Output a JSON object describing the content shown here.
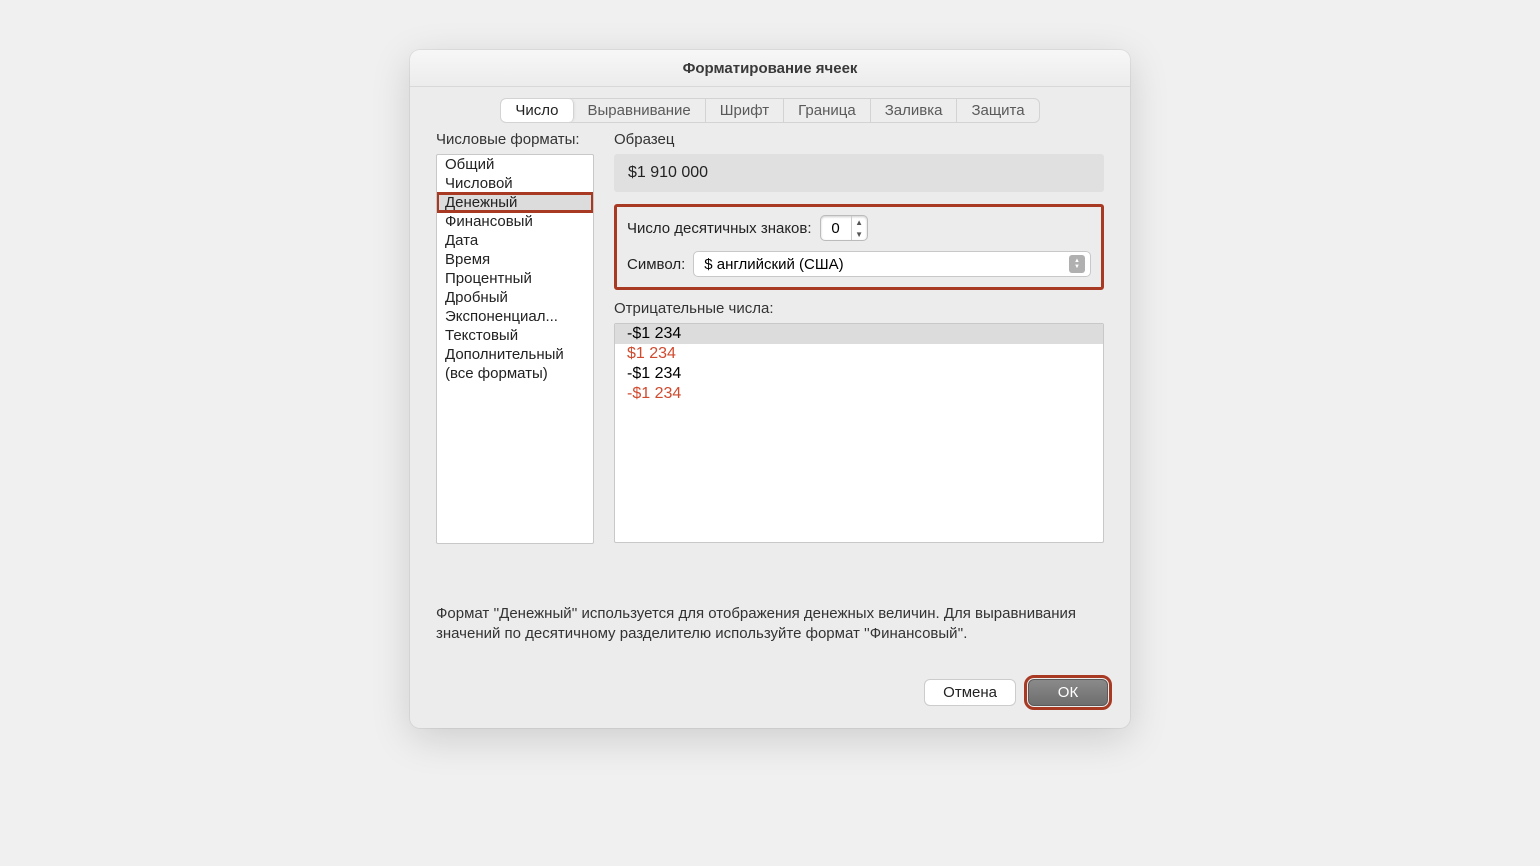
{
  "dialog": {
    "title": "Форматирование ячеек"
  },
  "tabs": [
    "Число",
    "Выравнивание",
    "Шрифт",
    "Граница",
    "Заливка",
    "Защита"
  ],
  "labels": {
    "categories": "Числовые форматы:",
    "sample": "Образец",
    "decimals": "Число десятичных знаков:",
    "symbol": "Символ:",
    "negative": "Отрицательные числа:"
  },
  "categories": [
    "Общий",
    "Числовой",
    "Денежный",
    "Финансовый",
    "Дата",
    "Время",
    "Процентный",
    "Дробный",
    "Экспоненциал...",
    "Текстовый",
    "Дополнительный",
    "(все форматы)"
  ],
  "sample_value": "$1 910 000",
  "decimals_value": "0",
  "symbol_value": "$ английский (США)",
  "negative_numbers": [
    {
      "text": "-$1 234",
      "red": false,
      "selected": true
    },
    {
      "text": "$1 234",
      "red": true,
      "selected": false
    },
    {
      "text": "-$1 234",
      "red": false,
      "selected": false
    },
    {
      "text": "-$1 234",
      "red": true,
      "selected": false
    }
  ],
  "description": "Формат ''Денежный'' используется для отображения денежных величин. Для выравнивания значений по десятичному разделителю используйте формат ''Финансовый''.",
  "buttons": {
    "cancel": "Отмена",
    "ok": "ОК"
  }
}
